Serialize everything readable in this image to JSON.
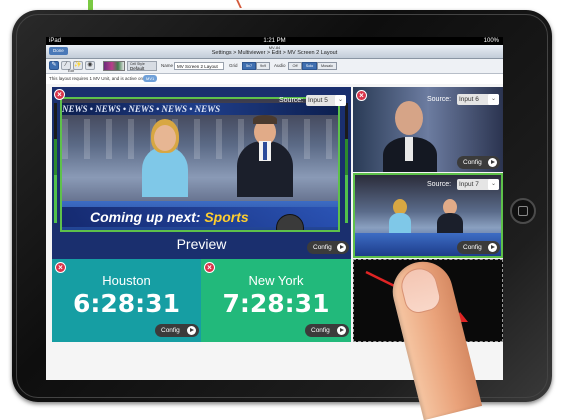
{
  "status_bar": {
    "carrier": "iPad",
    "time": "1:21 PM",
    "battery": "100%"
  },
  "nav": {
    "back": "Done",
    "subtitle": "MV-84",
    "title": "Settings > Multiviewer > Edit > MV Screen 2 Layout"
  },
  "toolbar": {
    "edit_label": "Edit",
    "cell_style_label": "Cell Style",
    "cell_style_value": "Default",
    "name_label": "Name",
    "name_value": "MV Screen 2 Layout",
    "grid_label": "Grid",
    "grid_options": [
      "5x7",
      "9x9"
    ],
    "grid_selected": "5x7",
    "audio_label": "Audio",
    "audio_options": [
      "Off",
      "Solo",
      "Mosaic"
    ],
    "audio_selected": "Solo"
  },
  "info": {
    "text": "This layout requires 1 MV Unit, and is active on:",
    "badge": "MV1"
  },
  "tiles": {
    "preview": {
      "source_label": "Source:",
      "source_value": "Input 5",
      "label": "Preview",
      "config": "Config",
      "banner": "NEWS • NEWS • NEWS • NEWS • NEWS",
      "lower_third_main": "Coming up next:",
      "lower_third_accent": "Sports"
    },
    "input6": {
      "source_label": "Source:",
      "source_value": "Input 6",
      "config": "Config"
    },
    "input7": {
      "source_label": "Source:",
      "source_value": "Input 7",
      "config": "Config"
    },
    "houston": {
      "name": "Houston",
      "time": "6:28:31",
      "config": "Config",
      "color": "#169ea3"
    },
    "newyork": {
      "name": "New York",
      "time": "7:28:31",
      "config": "Config",
      "color": "#22b97b"
    }
  },
  "colors": {
    "preview_bg": "#1a2f6e",
    "tally_green": "#5ec14a",
    "close_red": "#d9344a",
    "annotation_arrow": "#e02424"
  }
}
